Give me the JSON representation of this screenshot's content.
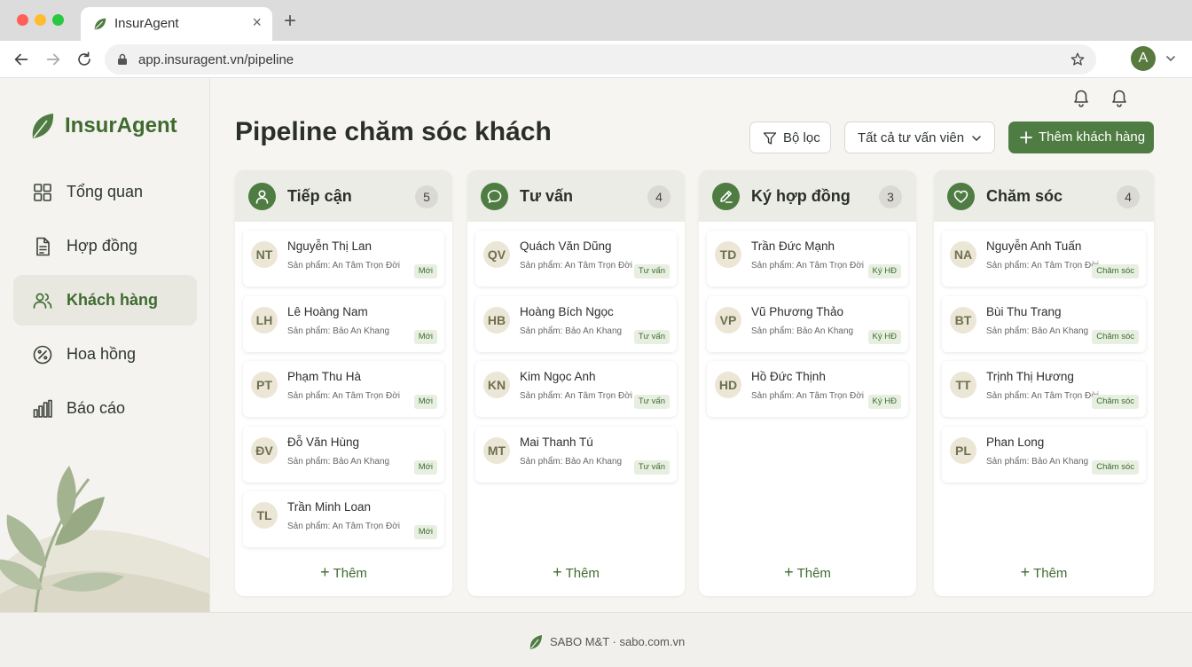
{
  "browser": {
    "tab_title": "InsurAgent",
    "url": "app.insuragent.vn/pipeline",
    "profile_initial": "A"
  },
  "brand": {
    "name": "InsurAgent",
    "color": "#3f6b2f"
  },
  "sidebar": {
    "items": [
      {
        "label": "Tổng quan",
        "icon": "grid-icon",
        "active": false
      },
      {
        "label": "Hợp đồng",
        "icon": "document-icon",
        "active": false
      },
      {
        "label": "Khách hàng",
        "icon": "users-icon",
        "active": true
      },
      {
        "label": "Hoa hồng",
        "icon": "percent-icon",
        "active": false
      },
      {
        "label": "Báo cáo",
        "icon": "bar-chart-icon",
        "active": false
      }
    ]
  },
  "header": {
    "title": "Pipeline chăm sóc khách",
    "filter_label": "Bộ lọc",
    "advisor_select": "Tất cả tư vấn viên",
    "add_customer_label": "Thêm khách hàng"
  },
  "columns": [
    {
      "title": "Tiếp cận",
      "count": "5",
      "icon": "user-icon",
      "cards": [
        {
          "initials": "NT",
          "name": "Nguyễn Thị Lan",
          "product": "Sản phẩm: An Tâm Trọn Đời",
          "badge": "Mới"
        },
        {
          "initials": "LH",
          "name": "Lê Hoàng Nam",
          "product": "Sản phẩm: Bảo An Khang",
          "badge": "Mới"
        },
        {
          "initials": "PT",
          "name": "Phạm Thu Hà",
          "product": "Sản phẩm: An Tâm Trọn Đời",
          "badge": "Mới"
        },
        {
          "initials": "ĐV",
          "name": "Đỗ Văn Hùng",
          "product": "Sản phẩm: Bảo An Khang",
          "badge": "Mới"
        },
        {
          "initials": "TL",
          "name": "Trần Minh Loan",
          "product": "Sản phẩm: An Tâm Trọn Đời",
          "badge": "Mới"
        }
      ],
      "add_label": "Thêm"
    },
    {
      "title": "Tư vấn",
      "count": "4",
      "icon": "chat-icon",
      "cards": [
        {
          "initials": "QV",
          "name": "Quách Văn Dũng",
          "product": "Sản phẩm: An Tâm Trọn Đời",
          "badge": "Tư vấn"
        },
        {
          "initials": "HB",
          "name": "Hoàng Bích Ngọc",
          "product": "Sản phẩm: Bảo An Khang",
          "badge": "Tư vấn"
        },
        {
          "initials": "KN",
          "name": "Kim Ngọc Anh",
          "product": "Sản phẩm: An Tâm Trọn Đời",
          "badge": "Tư vấn"
        },
        {
          "initials": "MT",
          "name": "Mai Thanh Tú",
          "product": "Sản phẩm: Bảo An Khang",
          "badge": "Tư vấn"
        }
      ],
      "add_label": "Thêm"
    },
    {
      "title": "Ký hợp đồng",
      "count": "3",
      "icon": "pen-icon",
      "cards": [
        {
          "initials": "TD",
          "name": "Trần Đức Mạnh",
          "product": "Sản phẩm: An Tâm Trọn Đời",
          "badge": "Ký HĐ"
        },
        {
          "initials": "VP",
          "name": "Vũ Phương Thảo",
          "product": "Sản phẩm: Bảo An Khang",
          "badge": "Ký HĐ"
        },
        {
          "initials": "HD",
          "name": "Hồ Đức Thịnh",
          "product": "Sản phẩm: An Tâm Trọn Đời",
          "badge": "Ký HĐ"
        }
      ],
      "add_label": "Thêm"
    },
    {
      "title": "Chăm sóc",
      "count": "4",
      "icon": "heart-icon",
      "cards": [
        {
          "initials": "NA",
          "name": "Nguyễn Anh Tuấn",
          "product": "Sản phẩm: An Tâm Trọn Đời",
          "badge": "Chăm sóc"
        },
        {
          "initials": "BT",
          "name": "Bùi Thu Trang",
          "product": "Sản phẩm: Bảo An Khang",
          "badge": "Chăm sóc"
        },
        {
          "initials": "TT",
          "name": "Trịnh Thị Hương",
          "product": "Sản phẩm: An Tâm Trọn Đời",
          "badge": "Chăm sóc"
        },
        {
          "initials": "PL",
          "name": "Phan Long",
          "product": "Sản phẩm: Bảo An Khang",
          "badge": "Chăm sóc"
        }
      ],
      "add_label": "Thêm"
    }
  ],
  "footer": {
    "text": "SABO M&T · sabo.com.vn"
  },
  "colors": {
    "accent": "#4f7c42",
    "badge_bg": "#e7efe0",
    "avatar_bg": "#ebe6d6"
  }
}
